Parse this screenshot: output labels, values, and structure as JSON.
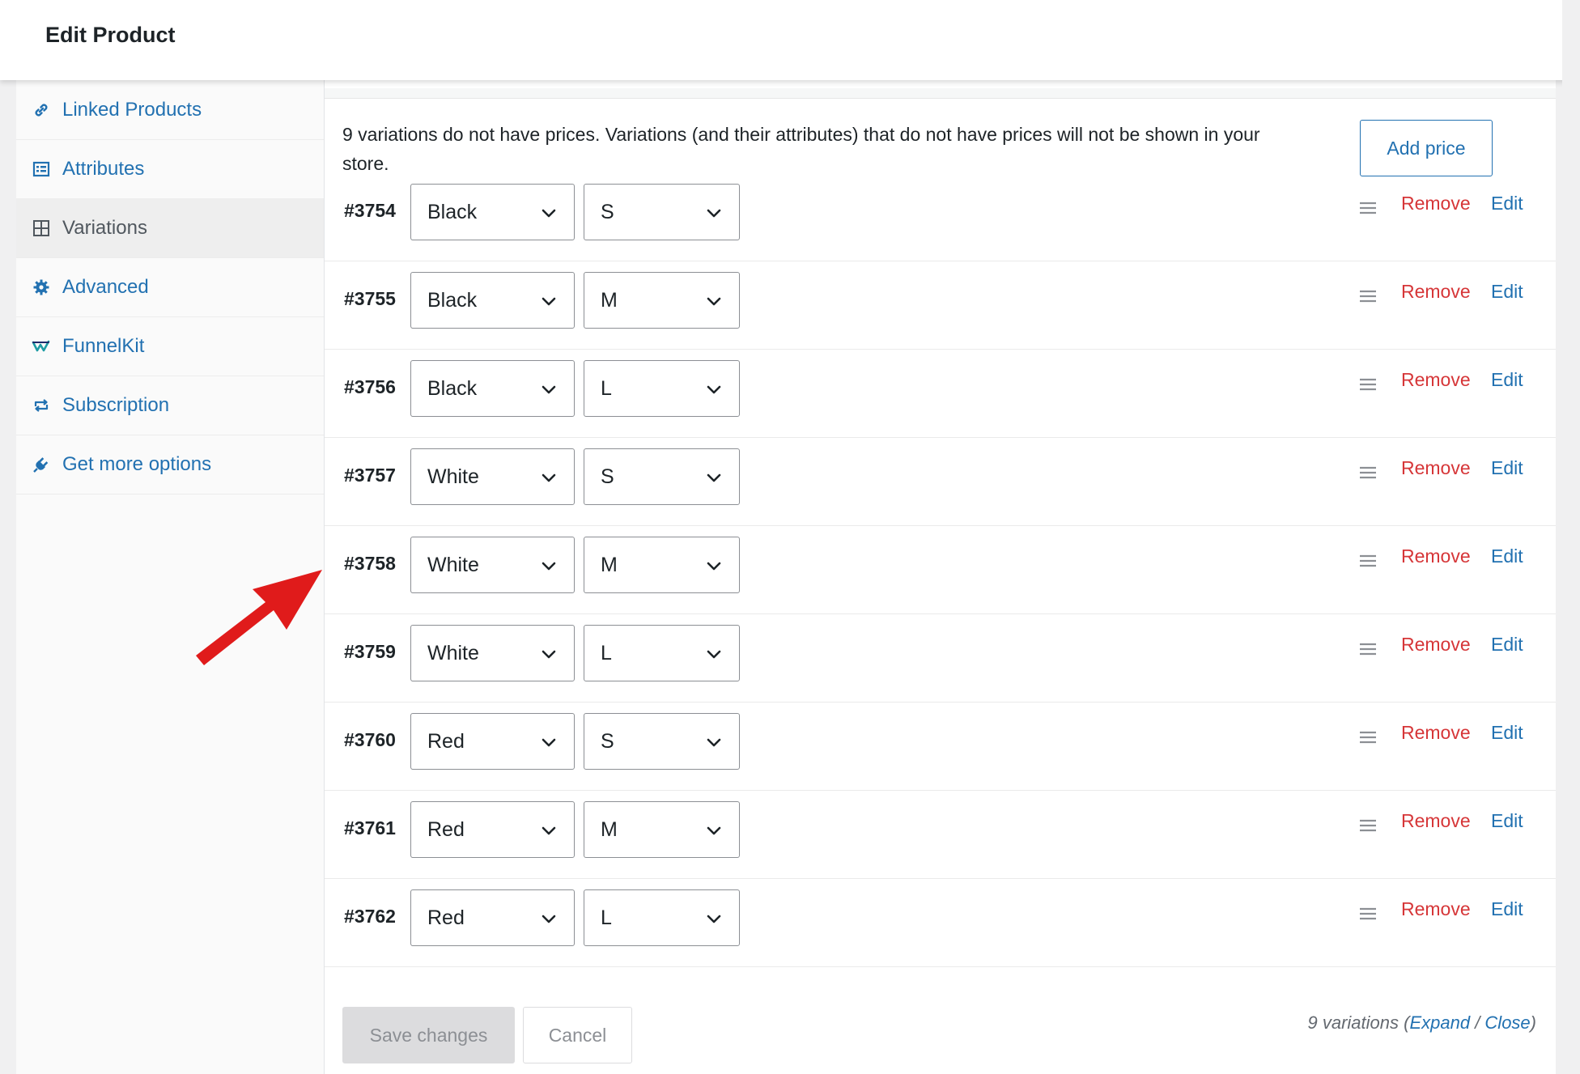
{
  "header": {
    "title": "Edit Product"
  },
  "sidebar": {
    "items": [
      {
        "label": "Linked Products",
        "icon": "link-icon",
        "active": false
      },
      {
        "label": "Attributes",
        "icon": "list-table-icon",
        "active": false
      },
      {
        "label": "Variations",
        "icon": "grid-icon",
        "active": true
      },
      {
        "label": "Advanced",
        "icon": "gear-icon",
        "active": false
      },
      {
        "label": "FunnelKit",
        "icon": "funnelkit-logo-icon",
        "active": false
      },
      {
        "label": "Subscription",
        "icon": "repeat-icon",
        "active": false
      },
      {
        "label": "Get more options",
        "icon": "plugin-icon",
        "active": false
      }
    ]
  },
  "notice": {
    "text": "9 variations do not have prices. Variations (and their attributes) that do not have prices will not be shown in your store.",
    "button_label": "Add price"
  },
  "row_actions": {
    "remove_label": "Remove",
    "edit_label": "Edit"
  },
  "variations": [
    {
      "id": "#3754",
      "color": "Black",
      "size": "S"
    },
    {
      "id": "#3755",
      "color": "Black",
      "size": "M"
    },
    {
      "id": "#3756",
      "color": "Black",
      "size": "L"
    },
    {
      "id": "#3757",
      "color": "White",
      "size": "S"
    },
    {
      "id": "#3758",
      "color": "White",
      "size": "M"
    },
    {
      "id": "#3759",
      "color": "White",
      "size": "L"
    },
    {
      "id": "#3760",
      "color": "Red",
      "size": "S"
    },
    {
      "id": "#3761",
      "color": "Red",
      "size": "M"
    },
    {
      "id": "#3762",
      "color": "Red",
      "size": "L"
    }
  ],
  "footer": {
    "save_label": "Save changes",
    "cancel_label": "Cancel",
    "count_text": "9 variations",
    "open_paren": " (",
    "expand_label": "Expand",
    "separator": " / ",
    "close_label": "Close",
    "close_paren": ")"
  },
  "colors": {
    "link": "#2271b1",
    "remove": "#d63638",
    "annotation_arrow": "#e01b1b"
  }
}
